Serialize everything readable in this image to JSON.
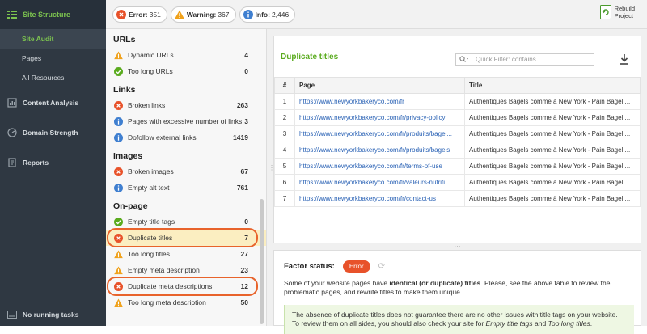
{
  "nav": {
    "header": "Site Structure",
    "sub_items": [
      "Site Audit",
      "Pages",
      "All Resources"
    ],
    "items": [
      {
        "label": "Content Analysis",
        "icon": "document-chart-icon"
      },
      {
        "label": "Domain Strength",
        "icon": "speedometer-icon"
      },
      {
        "label": "Reports",
        "icon": "report-icon"
      }
    ],
    "footer": "No running tasks"
  },
  "topbar": {
    "error": {
      "label": "Error:",
      "count": "351"
    },
    "warning": {
      "label": "Warning:",
      "count": "367"
    },
    "info": {
      "label": "Info:",
      "count": "2,446"
    },
    "rebuild_line1": "Rebuild",
    "rebuild_line2": "Project"
  },
  "left": {
    "sections": [
      {
        "title": "URLs",
        "rows": [
          {
            "status": "warning",
            "label": "Dynamic URLs",
            "count": "4"
          },
          {
            "status": "ok",
            "label": "Too long URLs",
            "count": "0"
          }
        ]
      },
      {
        "title": "Links",
        "rows": [
          {
            "status": "error",
            "label": "Broken links",
            "count": "263"
          },
          {
            "status": "info",
            "label": "Pages with excessive number of links",
            "count": "3"
          },
          {
            "status": "info",
            "label": "Dofollow external links",
            "count": "1419"
          }
        ]
      },
      {
        "title": "Images",
        "rows": [
          {
            "status": "error",
            "label": "Broken images",
            "count": "67"
          },
          {
            "status": "info",
            "label": "Empty alt text",
            "count": "761"
          }
        ]
      },
      {
        "title": "On-page",
        "rows": [
          {
            "status": "ok",
            "label": "Empty title tags",
            "count": "0"
          },
          {
            "status": "error",
            "label": "Duplicate titles",
            "count": "7",
            "selected": true,
            "ring": true
          },
          {
            "status": "warning",
            "label": "Too long titles",
            "count": "27"
          },
          {
            "status": "warning",
            "label": "Empty meta description",
            "count": "23"
          },
          {
            "status": "error",
            "label": "Duplicate meta descriptions",
            "count": "12",
            "ring": true
          },
          {
            "status": "warning",
            "label": "Too long meta description",
            "count": "50"
          }
        ]
      }
    ]
  },
  "right": {
    "title": "Duplicate titles",
    "filter_placeholder": "Quick Filter: contains",
    "columns": [
      "#",
      "Page",
      "Title"
    ],
    "rows": [
      [
        "1",
        "https://www.newyorkbakeryco.com/fr",
        "Authentiques Bagels comme à New York - Pain Bagel ..."
      ],
      [
        "2",
        "https://www.newyorkbakeryco.com/fr/privacy-policy",
        "Authentiques Bagels comme à New York - Pain Bagel ..."
      ],
      [
        "3",
        "https://www.newyorkbakeryco.com/fr/produits/bagel...",
        "Authentiques Bagels comme à New York - Pain Bagel ..."
      ],
      [
        "4",
        "https://www.newyorkbakeryco.com/fr/produits/bagels",
        "Authentiques Bagels comme à New York - Pain Bagel ..."
      ],
      [
        "5",
        "https://www.newyorkbakeryco.com/fr/terms-of-use",
        "Authentiques Bagels comme à New York - Pain Bagel ..."
      ],
      [
        "6",
        "https://www.newyorkbakeryco.com/fr/valeurs-nutriti...",
        "Authentiques Bagels comme à New York - Pain Bagel ..."
      ],
      [
        "7",
        "https://www.newyorkbakeryco.com/fr/contact-us",
        "Authentiques Bagels comme à New York - Pain Bagel ..."
      ]
    ],
    "factor_label": "Factor status:",
    "factor_status": "Error",
    "desc_pre": "Some of your website pages have ",
    "desc_bold": "identical (or duplicate) titles",
    "desc_post": ". Please, see the above table to review the problematic pages, and rewrite titles to make them unique.",
    "note_line1": "The absence of duplicate titles does not guarantee there are no other issues with title tags on your website.",
    "note_line2_pre": "To review them on all sides, you should also check your site for ",
    "note_em1": "Empty title tags",
    "note_and": " and ",
    "note_em2": "Too long titles",
    "note_end": "."
  },
  "colors": {
    "accent": "#5aab1e",
    "error": "#e8522a",
    "warning": "#f0a21c",
    "info": "#3f7fd0",
    "ok": "#5aab1e"
  }
}
